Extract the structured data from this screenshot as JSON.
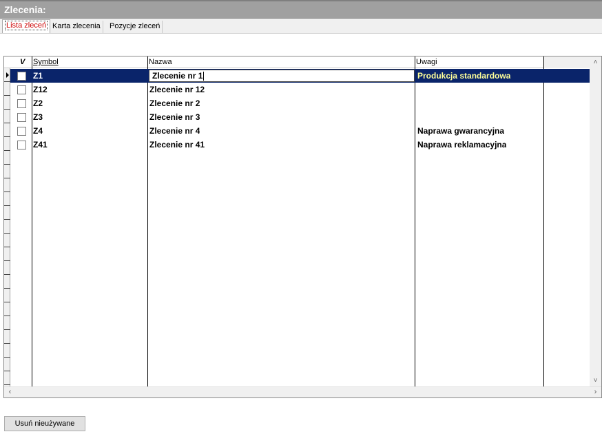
{
  "window": {
    "title": "Zlecenia:"
  },
  "tabs": [
    {
      "label": "Lista zleceń",
      "active": true
    },
    {
      "label": "Karta zlecenia",
      "active": false
    },
    {
      "label": "Pozycje zleceń",
      "active": false
    }
  ],
  "grid": {
    "headers": {
      "check": "V",
      "symbol": "Symbol",
      "name": "Nazwa",
      "remarks": "Uwagi"
    },
    "rows": [
      {
        "symbol": "Z1",
        "name": "Zlecenie nr 1",
        "remarks": "Produkcja standardowa",
        "checked": false,
        "selected": true
      },
      {
        "symbol": "Z12",
        "name": "Zlecenie nr 12",
        "remarks": "",
        "checked": false,
        "selected": false
      },
      {
        "symbol": "Z2",
        "name": "Zlecenie nr 2",
        "remarks": "",
        "checked": false,
        "selected": false
      },
      {
        "symbol": "Z3",
        "name": "Zlecenie nr 3",
        "remarks": "",
        "checked": false,
        "selected": false
      },
      {
        "symbol": "Z4",
        "name": "Zlecenie nr 4",
        "remarks": "Naprawa gwarancyjna",
        "checked": false,
        "selected": false
      },
      {
        "symbol": "Z41",
        "name": "Zlecenie nr 41",
        "remarks": "Naprawa reklamacyjna",
        "checked": false,
        "selected": false
      }
    ],
    "scroll_icons": {
      "up": "chevron-up-icon",
      "down": "chevron-down-icon",
      "left": "chevron-left-icon",
      "right": "chevron-right-icon"
    }
  },
  "buttons": {
    "delete_unused": "Usuń nieużywane"
  },
  "colors": {
    "title_bar": "#a0a0a0",
    "selection": "#0a246a",
    "active_tab_text": "#cc0000",
    "remark_highlight": "#ffff99"
  }
}
